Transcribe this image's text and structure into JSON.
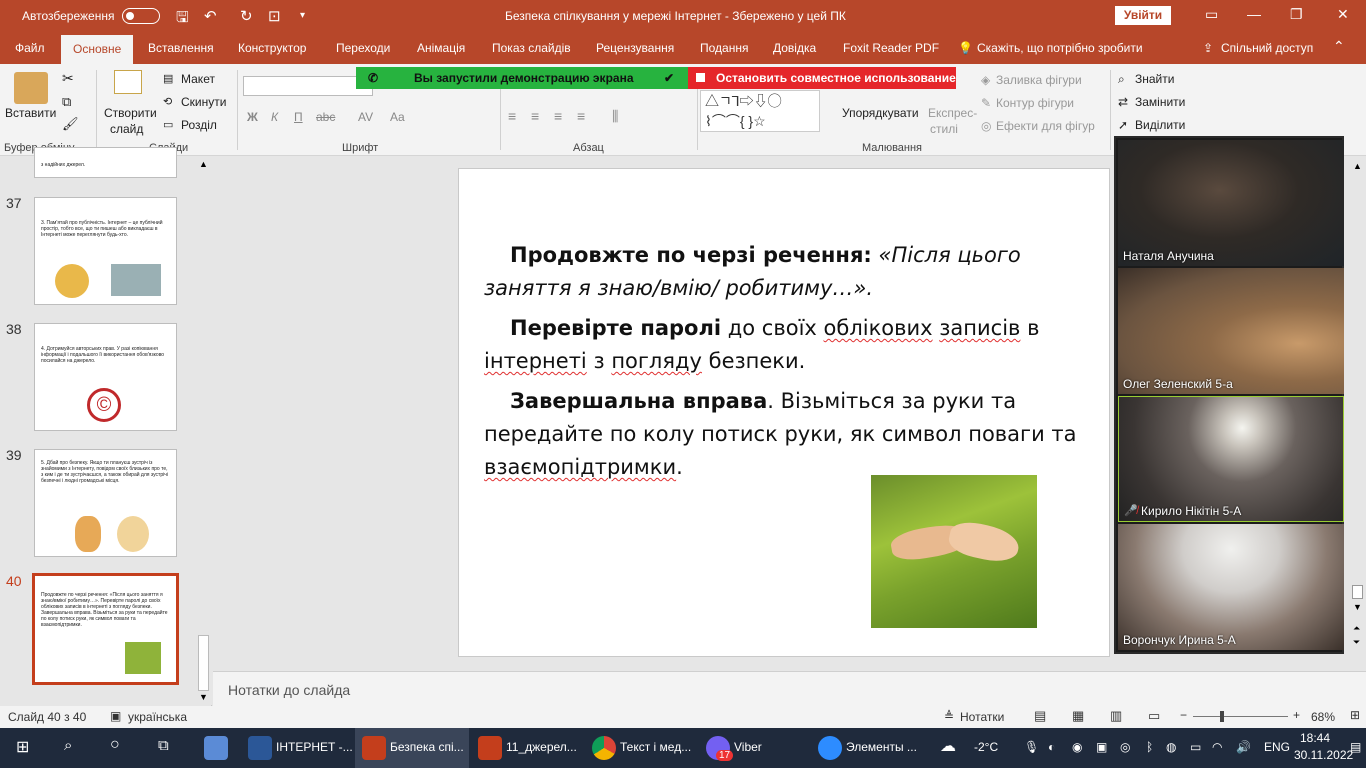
{
  "titlebar": {
    "autosave_label": "Автозбереження",
    "doc_title": "Безпека спілкування у мережі Інтернет  -  Збережено у цей ПК",
    "signin_label": "Увійти"
  },
  "tabs": [
    "Файл",
    "Основне",
    "Вставлення",
    "Конструктор",
    "Переходи",
    "Анімація",
    "Показ слайдів",
    "Рецензування",
    "Подання",
    "Довідка",
    "Foxit Reader PDF"
  ],
  "tell_me": "Скажіть, що потрібно зробити",
  "share_label": "Спільний доступ",
  "ribbon": {
    "paste": "Вставити",
    "new_slide_1": "Створити",
    "new_slide_2": "слайд",
    "layout": "Макет",
    "reset": "Скинути",
    "section": "Розділ",
    "bold": "Ж",
    "italic": "К",
    "underline": "П",
    "strike": "abc",
    "spacing": "AV",
    "case": "Aa",
    "arrange": "Упорядкувати",
    "quick_styles_1": "Експрес-",
    "quick_styles_2": "стилі",
    "fill": "Заливка фігури",
    "outline": "Контур фігури",
    "effects": "Ефекти для фігур",
    "find": "Знайти",
    "replace": "Замінити",
    "select": "Виділити",
    "groups": {
      "clipboard": "Буфер обміну",
      "slides": "Слайди",
      "font": "Шрифт",
      "paragraph": "Абзац",
      "drawing": "Малювання"
    }
  },
  "share_banner": {
    "green_text": "Вы запустили демонстрацию экрана",
    "red_text": "Остановить совместное использование"
  },
  "thumbnails": [
    {
      "num": "",
      "text": "з надійних джерел."
    },
    {
      "num": "37",
      "text": "3. Пам'ятай про публічність. Інтернет – це публічний простір, тобто все, що ти пишеш або викладаєш в Інтернеті може переглянути будь-хто."
    },
    {
      "num": "38",
      "text": "4. Дотримуйся авторських прав. У разі копіювання інформації і подальшого її використання обов'язково посилайся на джерело."
    },
    {
      "num": "39",
      "text": "5. Дбай про безпеку. Якщо ти плануєш зустріч із знайомими з Інтернету, повідом своїх близьких про те, з ким і де ти зустрічаєшся, а також обирай для зустрічі безпечні і людні громадські місця."
    },
    {
      "num": "40",
      "text": "Продовжте по черзі речення: «Після цього заняття я знаю/вмію/ робитиму…». Перевірте паролі до своїх облікових записів в інтернеті з погляду безпеки. Завершальна вправа. Візьміться за руки та передайте по колу потиск руки, як символ поваги та взаємопідтримки."
    }
  ],
  "slide": {
    "p1_bold": "Продовжте по черзі речення:",
    "p1_italic_a": "«Після цього",
    "p1_italic_b": "заняття я знаю/вмію/ робитиму…».",
    "p2_bold": "Перевірте паролі",
    "p2_a": "до своїх",
    "p2_u1": "облікових",
    "p2_u2": "записів",
    "p2_b": "в",
    "p2_u3": "інтернеті",
    "p2_c": "з",
    "p2_u4": "погляду",
    "p2_d": "безпеки.",
    "p3_bold": "Завершальна вправа",
    "p3_a": ". Візьміться за руки та передайте по колу потиск руки, як символ поваги та",
    "p3_u": "взаємопідтримки",
    "p3_b": "."
  },
  "notes_placeholder": "Нотатки до слайда",
  "zoom_participants": [
    {
      "name": "Наталя Анучина",
      "muted": false
    },
    {
      "name": "Олег Зеленский 5-а",
      "muted": false
    },
    {
      "name": "Кирило Нікітін 5-А",
      "muted": true
    },
    {
      "name": "Ворончук Ирина 5-А",
      "muted": false
    }
  ],
  "status": {
    "slide_counter": "Слайд 40 з 40",
    "language": "українська",
    "notes": "Нотатки",
    "zoom": "68%"
  },
  "taskbar": {
    "apps": [
      "ІНТЕРНЕТ -...",
      "Безпека спі...",
      "11_джерел...",
      "Текст і мед...",
      "Viber",
      "Элементы ..."
    ],
    "viber_badge": "17",
    "weather": "-2°C",
    "lang": "ENG",
    "time": "18:44",
    "date": "30.11.2022"
  },
  "colors": {
    "accent": "#b7472a",
    "selected": "#c43e1c",
    "share_green": "#27b33f",
    "share_red": "#e5262a"
  }
}
